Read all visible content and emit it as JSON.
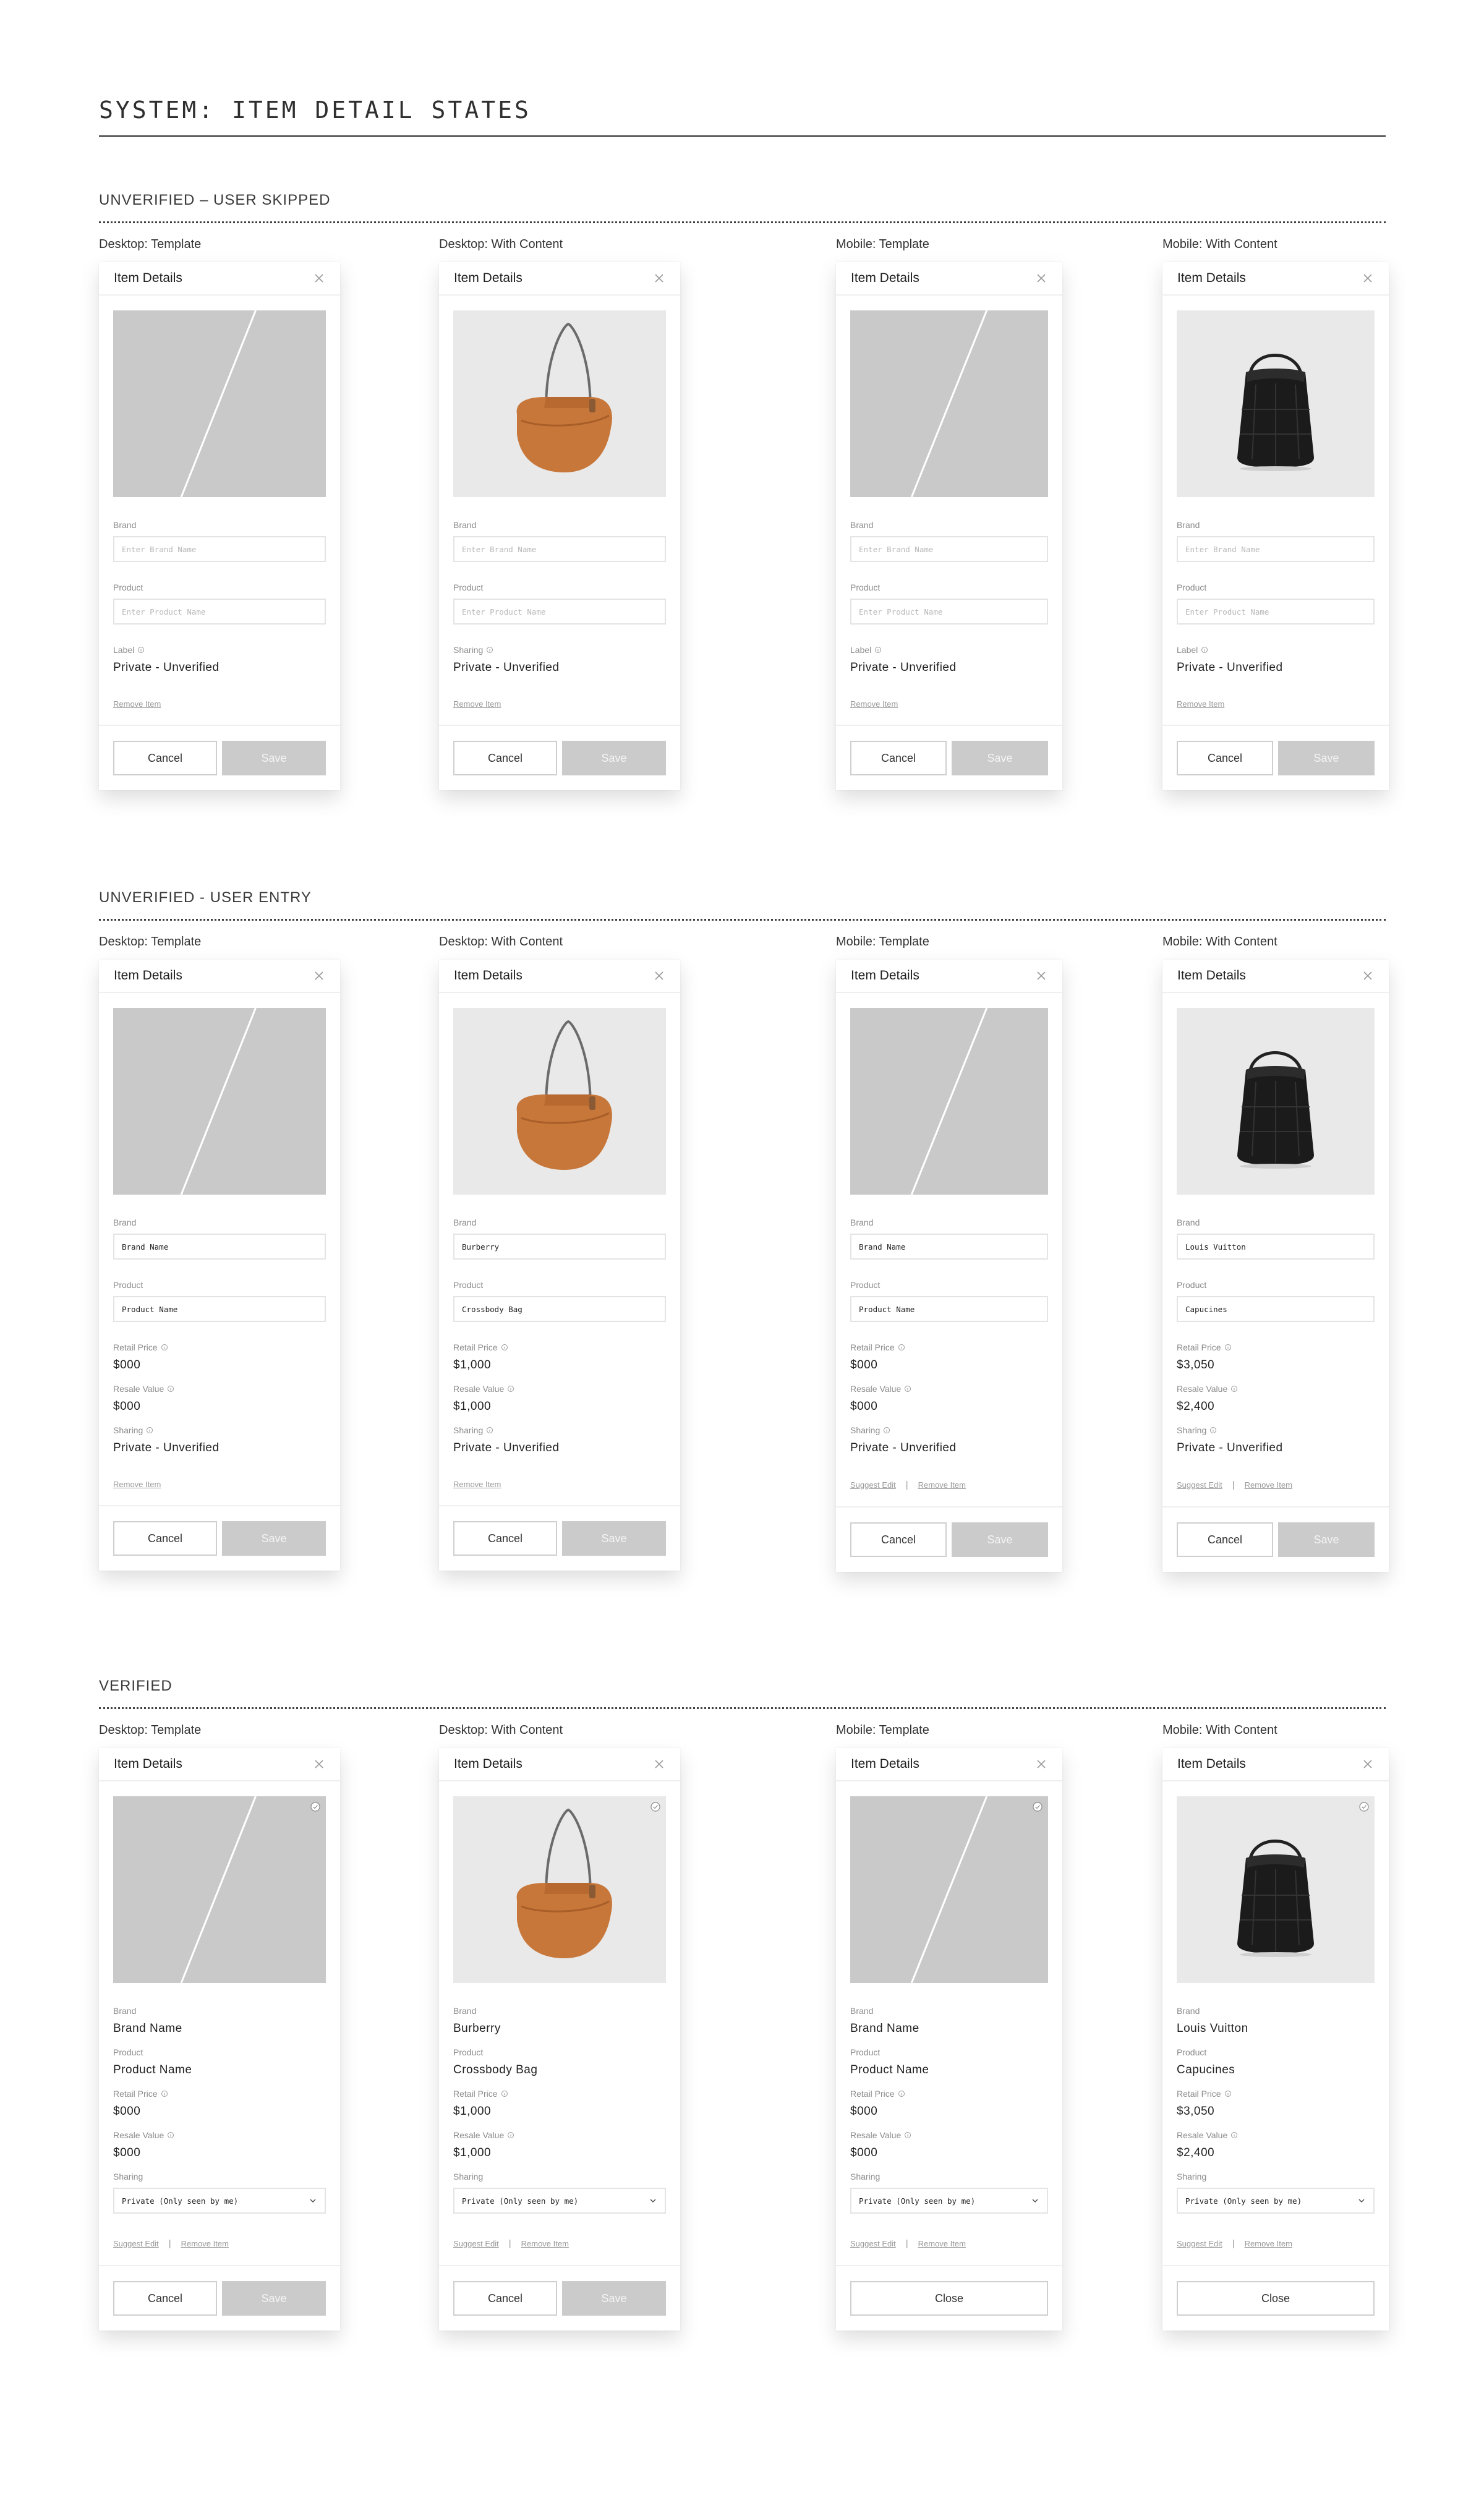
{
  "page_title": "SYSTEM: ITEM DETAIL STATES",
  "labels": {
    "modal_title": "Item Details",
    "brand": "Brand",
    "product": "Product",
    "label": "Label",
    "sharing": "Sharing",
    "retail_price": "Retail Price",
    "resale_value": "Resale Value",
    "remove_item": "Remove Item",
    "suggest_edit": "Suggest Edit",
    "cancel": "Cancel",
    "save": "Save",
    "close": "Close",
    "brand_placeholder": "Enter Brand Name",
    "product_placeholder": "Enter Product Name"
  },
  "colors": {
    "placeholder_gray": "#c9c9c9",
    "photo_bg": "#e9e9e9",
    "save_disabled": "#cbcbcb",
    "bag_tan": "#c8773a",
    "bag_black": "#1b1b1b"
  },
  "sections": [
    {
      "heading": "UNVERIFIED – USER SKIPPED",
      "variants": [
        {
          "label": "Desktop: Template",
          "image": "placeholder",
          "brand": "",
          "product": "",
          "status_label": "Label",
          "status_value": "Private - Unverified"
        },
        {
          "label": "Desktop: With Content",
          "image": "tan-crossbody-bag",
          "brand": "",
          "product": "",
          "status_label": "Sharing",
          "status_value": "Private - Unverified"
        },
        {
          "label": "Mobile: Template",
          "image": "placeholder",
          "brand": "",
          "product": "",
          "status_label": "Label",
          "status_value": "Private - Unverified"
        },
        {
          "label": "Mobile: With Content",
          "image": "black-bucket-bag",
          "brand": "",
          "product": "",
          "status_label": "Label",
          "status_value": "Private - Unverified"
        }
      ]
    },
    {
      "heading": "UNVERIFIED - USER ENTRY",
      "variants": [
        {
          "label": "Desktop: Template",
          "image": "placeholder",
          "brand": "Brand Name",
          "product": "Product Name",
          "retail_price": "$000",
          "resale_value": "$000",
          "sharing": "Private - Unverified"
        },
        {
          "label": "Desktop: With Content",
          "image": "tan-crossbody-bag",
          "brand": "Burberry",
          "product": "Crossbody Bag",
          "retail_price": "$1,000",
          "resale_value": "$1,000",
          "sharing": "Private - Unverified"
        },
        {
          "label": "Mobile: Template",
          "image": "placeholder",
          "brand": "Brand Name",
          "product": "Product Name",
          "retail_price": "$000",
          "resale_value": "$000",
          "sharing": "Private - Unverified"
        },
        {
          "label": "Mobile: With Content",
          "image": "black-bucket-bag",
          "brand": "Louis Vuitton",
          "product": "Capucines",
          "retail_price": "$3,050",
          "resale_value": "$2,400",
          "sharing": "Private - Unverified"
        }
      ]
    },
    {
      "heading": "VERIFIED",
      "variants": [
        {
          "label": "Desktop: Template",
          "image": "placeholder",
          "brand": "Brand Name",
          "product": "Product Name",
          "retail_price": "$000",
          "resale_value": "$000",
          "sharing_option": "Private (Only seen by me)"
        },
        {
          "label": "Desktop: With Content",
          "image": "tan-crossbody-bag",
          "brand": "Burberry",
          "product": "Crossbody Bag",
          "retail_price": "$1,000",
          "resale_value": "$1,000",
          "sharing_option": "Private (Only seen by me)"
        },
        {
          "label": "Mobile: Template",
          "image": "placeholder",
          "brand": "Brand Name",
          "product": "Product Name",
          "retail_price": "$000",
          "resale_value": "$000",
          "sharing_option": "Private (Only seen by me)"
        },
        {
          "label": "Mobile: With Content",
          "image": "black-bucket-bag",
          "brand": "Louis Vuitton",
          "product": "Capucines",
          "retail_price": "$3,050",
          "resale_value": "$2,400",
          "sharing_option": "Private (Only seen by me)"
        }
      ]
    }
  ]
}
